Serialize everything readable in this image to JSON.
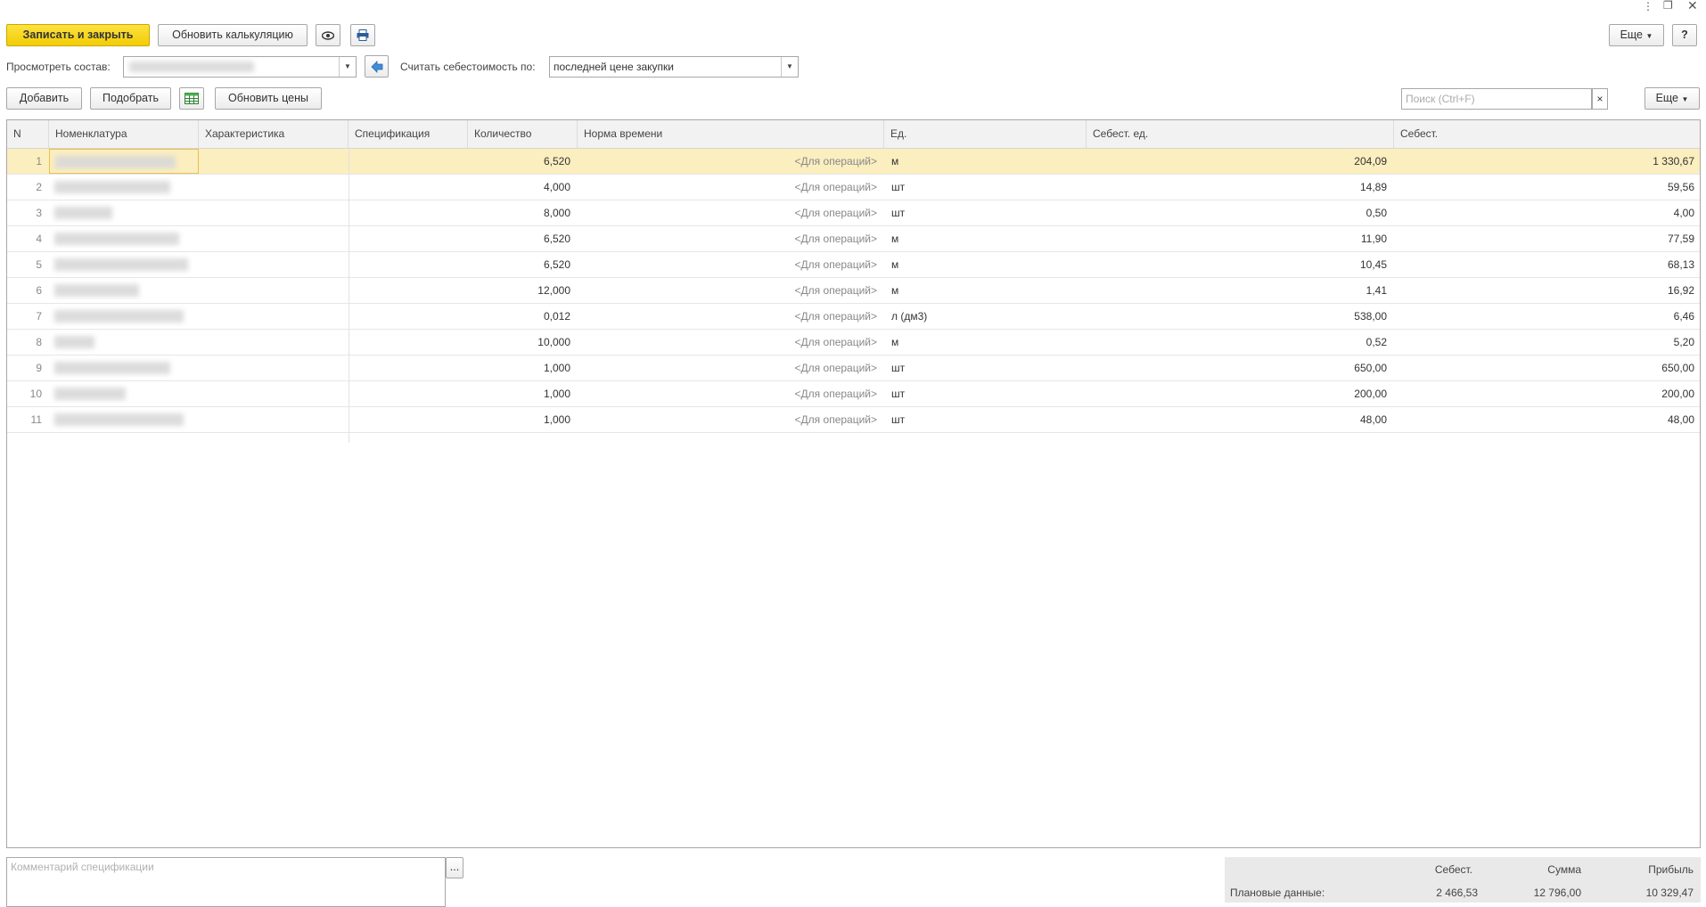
{
  "toolbar": {
    "save_close": "Записать и закрыть",
    "refresh_calc": "Обновить калькуляцию",
    "more": "Еще",
    "help": "?"
  },
  "filter": {
    "view_label": "Просмотреть состав:",
    "cost_label": "Считать себестоимость по:",
    "cost_value": "последней цене закупки"
  },
  "table_toolbar": {
    "add": "Добавить",
    "pick": "Подобрать",
    "refresh_prices": "Обновить цены",
    "search_placeholder": "Поиск (Ctrl+F)",
    "clear": "×",
    "more": "Еще"
  },
  "table": {
    "columns": [
      "N",
      "Номенклатура",
      "Характеристика",
      "Спецификация",
      "Количество",
      "Норма времени",
      "Ед.",
      "Себест. ед.",
      "Себест."
    ],
    "rows": [
      {
        "n": "1",
        "qty": "6,520",
        "norm": "<Для операций>",
        "unit": "м",
        "unit_cost": "204,09",
        "cost": "1 330,67"
      },
      {
        "n": "2",
        "qty": "4,000",
        "norm": "<Для операций>",
        "unit": "шт",
        "unit_cost": "14,89",
        "cost": "59,56"
      },
      {
        "n": "3",
        "qty": "8,000",
        "norm": "<Для операций>",
        "unit": "шт",
        "unit_cost": "0,50",
        "cost": "4,00"
      },
      {
        "n": "4",
        "qty": "6,520",
        "norm": "<Для операций>",
        "unit": "м",
        "unit_cost": "11,90",
        "cost": "77,59"
      },
      {
        "n": "5",
        "qty": "6,520",
        "norm": "<Для операций>",
        "unit": "м",
        "unit_cost": "10,45",
        "cost": "68,13"
      },
      {
        "n": "6",
        "qty": "12,000",
        "norm": "<Для операций>",
        "unit": "м",
        "unit_cost": "1,41",
        "cost": "16,92"
      },
      {
        "n": "7",
        "qty": "0,012",
        "norm": "<Для операций>",
        "unit": "л (дм3)",
        "unit_cost": "538,00",
        "cost": "6,46"
      },
      {
        "n": "8",
        "qty": "10,000",
        "norm": "<Для операций>",
        "unit": "м",
        "unit_cost": "0,52",
        "cost": "5,20"
      },
      {
        "n": "9",
        "qty": "1,000",
        "norm": "<Для операций>",
        "unit": "шт",
        "unit_cost": "650,00",
        "cost": "650,00"
      },
      {
        "n": "10",
        "qty": "1,000",
        "norm": "<Для операций>",
        "unit": "шт",
        "unit_cost": "200,00",
        "cost": "200,00"
      },
      {
        "n": "11",
        "qty": "1,000",
        "norm": "<Для операций>",
        "unit": "шт",
        "unit_cost": "48,00",
        "cost": "48,00"
      }
    ]
  },
  "comment": {
    "placeholder": "Комментарий спецификации",
    "button": "..."
  },
  "summary": {
    "col_cost": "Себест.",
    "col_sum": "Сумма",
    "col_profit": "Прибыль",
    "row_label": "Плановые данные:",
    "cost": "2 466,53",
    "sum": "12 796,00",
    "profit": "10 329,47"
  },
  "colors": {
    "accent_yellow": "#f2cc05",
    "selected_row": "#fbeebf",
    "nav_blue": "#4a90d9"
  },
  "icons": [
    "eye-icon",
    "print-icon",
    "arrow-left-icon",
    "excel-icon",
    "more-vert-icon",
    "restore-icon",
    "close-icon",
    "dropdown-icon"
  ]
}
